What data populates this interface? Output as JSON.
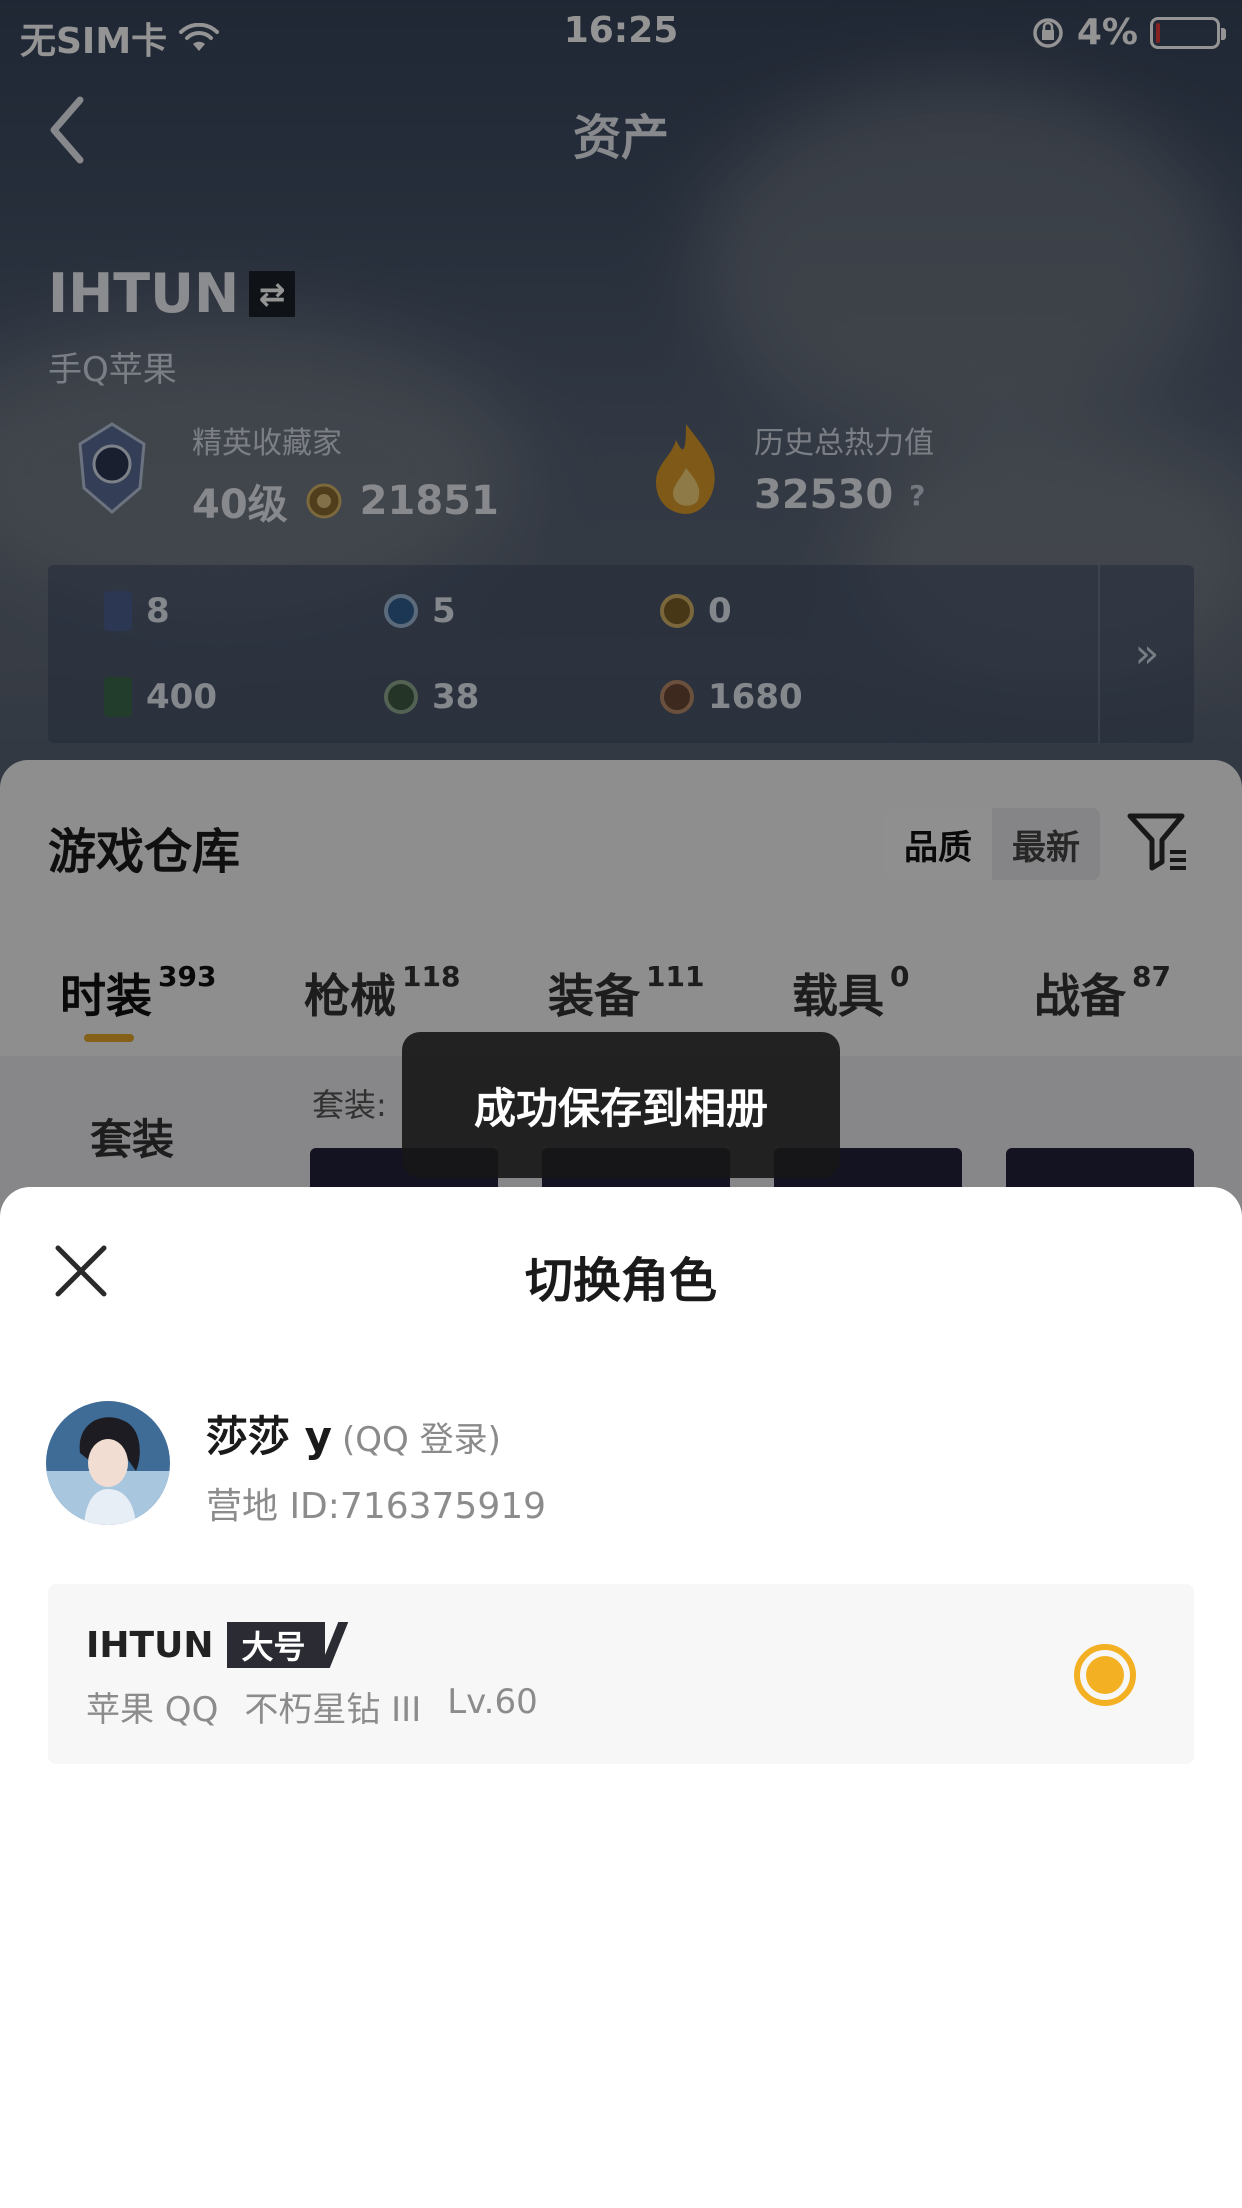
{
  "status_bar": {
    "carrier": "无SIM卡",
    "time": "16:25",
    "battery": "4%"
  },
  "nav": {
    "title": "资产"
  },
  "player": {
    "name": "IHTUN",
    "platform": "手Q苹果",
    "online_status": "",
    "collector_title": "精英收藏家",
    "collector_level": "40级",
    "collector_points": "21851",
    "heat_label": "历史总热力值",
    "heat_value": "32530",
    "heat_help": "?"
  },
  "resources": [
    {
      "value": "8",
      "icon": "card-icon"
    },
    {
      "value": "5",
      "icon": "blue-coin-icon"
    },
    {
      "value": "0",
      "icon": "gold-coin-icon"
    },
    {
      "value": "400",
      "icon": "green-card-icon"
    },
    {
      "value": "38",
      "icon": "green-coin-icon"
    },
    {
      "value": "1680",
      "icon": "copper-coin-icon"
    }
  ],
  "resources_more": "»",
  "warehouse": {
    "title": "游戏仓库",
    "sort_quality": "品质",
    "sort_newest": "最新",
    "tabs": [
      {
        "label": "时装",
        "count": "393"
      },
      {
        "label": "枪械",
        "count": "118"
      },
      {
        "label": "装备",
        "count": "111"
      },
      {
        "label": "载具",
        "count": "0"
      },
      {
        "label": "战备",
        "count": "87"
      }
    ],
    "side_category": "套装",
    "set_count_label": "套装:"
  },
  "toast": {
    "message": "成功保存到相册"
  },
  "sheet": {
    "title": "切换角色",
    "account": {
      "name": "莎莎 y",
      "login_type": "(QQ 登录)",
      "camp_id": "营地 ID:716375919"
    },
    "role": {
      "name": "IHTUN",
      "tag": "大号",
      "platform": "苹果 QQ",
      "rank": "不朽星钻 III",
      "level": "Lv.60",
      "selected": true
    }
  },
  "colors": {
    "accent": "#f4b023",
    "tab_underline": "#e4a52a",
    "sheet_bg": "#ffffff"
  }
}
